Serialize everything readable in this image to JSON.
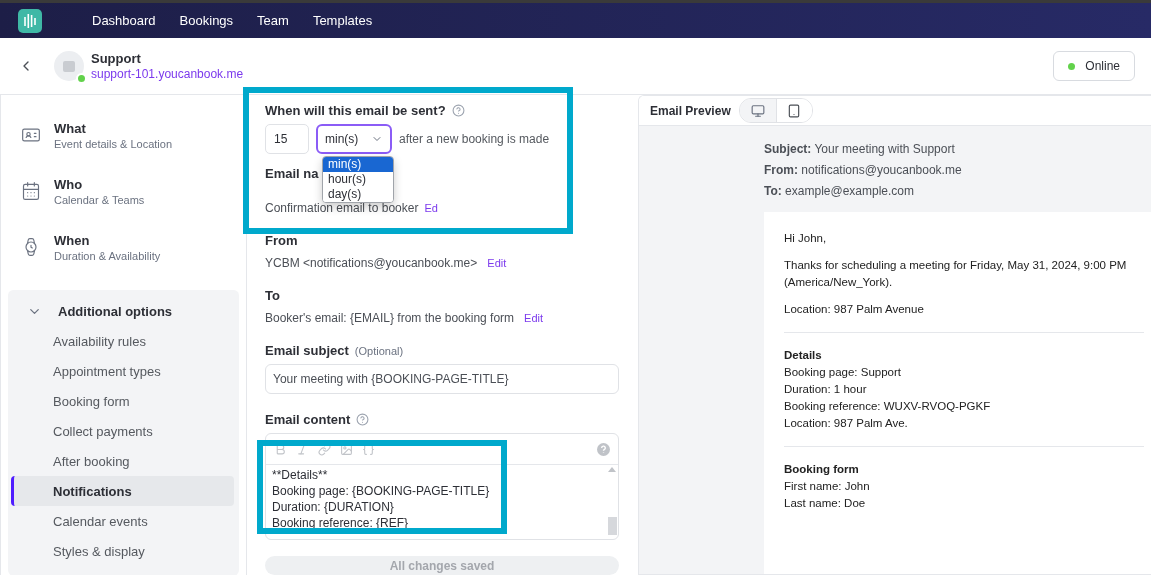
{
  "nav": {
    "items": [
      {
        "label": "Dashboard"
      },
      {
        "label": "Bookings"
      },
      {
        "label": "Team"
      },
      {
        "label": "Templates"
      }
    ]
  },
  "header": {
    "title": "Support",
    "url": "support-101.youcanbook.me",
    "online": true,
    "status": "Online"
  },
  "sidebar": {
    "steps": [
      {
        "kind": "what",
        "title": "What",
        "subtitle": "Event details & Location"
      },
      {
        "kind": "who",
        "title": "Who",
        "subtitle": "Calendar & Teams"
      },
      {
        "kind": "when",
        "title": "When",
        "subtitle": "Duration & Availability"
      }
    ],
    "section": {
      "title": "Additional options",
      "expanded": true,
      "items": [
        {
          "label": "Availability rules",
          "selected": false
        },
        {
          "label": "Appointment types",
          "selected": false
        },
        {
          "label": "Booking form",
          "selected": false
        },
        {
          "label": "Collect payments",
          "selected": false
        },
        {
          "label": "After booking",
          "selected": false
        },
        {
          "label": "Notifications",
          "selected": true
        },
        {
          "label": "Calendar events",
          "selected": false
        },
        {
          "label": "Styles & display",
          "selected": false
        }
      ]
    }
  },
  "form": {
    "send_time": {
      "label": "When will this email be sent?",
      "amount": "15",
      "unit": "min(s)",
      "suffix": "after a new booking is made",
      "options": [
        {
          "label": "min(s)",
          "selected": true
        },
        {
          "label": "hour(s)",
          "selected": false
        },
        {
          "label": "day(s)",
          "selected": false
        }
      ]
    },
    "email_name": {
      "label": "Email na",
      "value": "Confirmation email to booker",
      "edit": "Ed"
    },
    "from": {
      "label": "From",
      "value": "YCBM <notifications@youcanbook.me>",
      "edit": "Edit"
    },
    "to": {
      "label": "To",
      "value": "Booker's email: {EMAIL} from the booking form",
      "edit": "Edit"
    },
    "subject": {
      "label": "Email subject",
      "hint": "(Optional)",
      "value": "Your meeting with {BOOKING-PAGE-TITLE}"
    },
    "content": {
      "label": "Email content",
      "lines": [
        "**Details**",
        "Booking page: {BOOKING-PAGE-TITLE}",
        "Duration: {DURATION}",
        "Booking reference: {REF}"
      ]
    },
    "save": {
      "label": "All changes saved",
      "disabled": true
    }
  },
  "preview": {
    "title": "Email Preview",
    "devices": [
      {
        "kind": "desktop",
        "selected": true
      },
      {
        "kind": "mobile",
        "selected": false
      }
    ],
    "meta": [
      {
        "label": "Subject:",
        "value": "Your meeting with Support"
      },
      {
        "label": "From:",
        "value": "notifications@youcanbook.me"
      },
      {
        "label": "To:",
        "value": "example@example.com"
      }
    ],
    "greeting": "Hi John,",
    "intro": [
      "Thanks for scheduling a meeting for Friday, May 31, 2024, 9:00 PM",
      "(America/New_York)."
    ],
    "location": "Location: 987 Palm Avenue",
    "sections": [
      {
        "title": "Details",
        "lines": [
          "Booking page: Support",
          "Duration: 1 hour",
          "Booking reference: WUXV-RVOQ-PGKF",
          "Location: 987 Palm Ave."
        ]
      },
      {
        "title": "Booking form",
        "lines": [
          "First name: John",
          "Last name: Doe"
        ]
      }
    ]
  }
}
